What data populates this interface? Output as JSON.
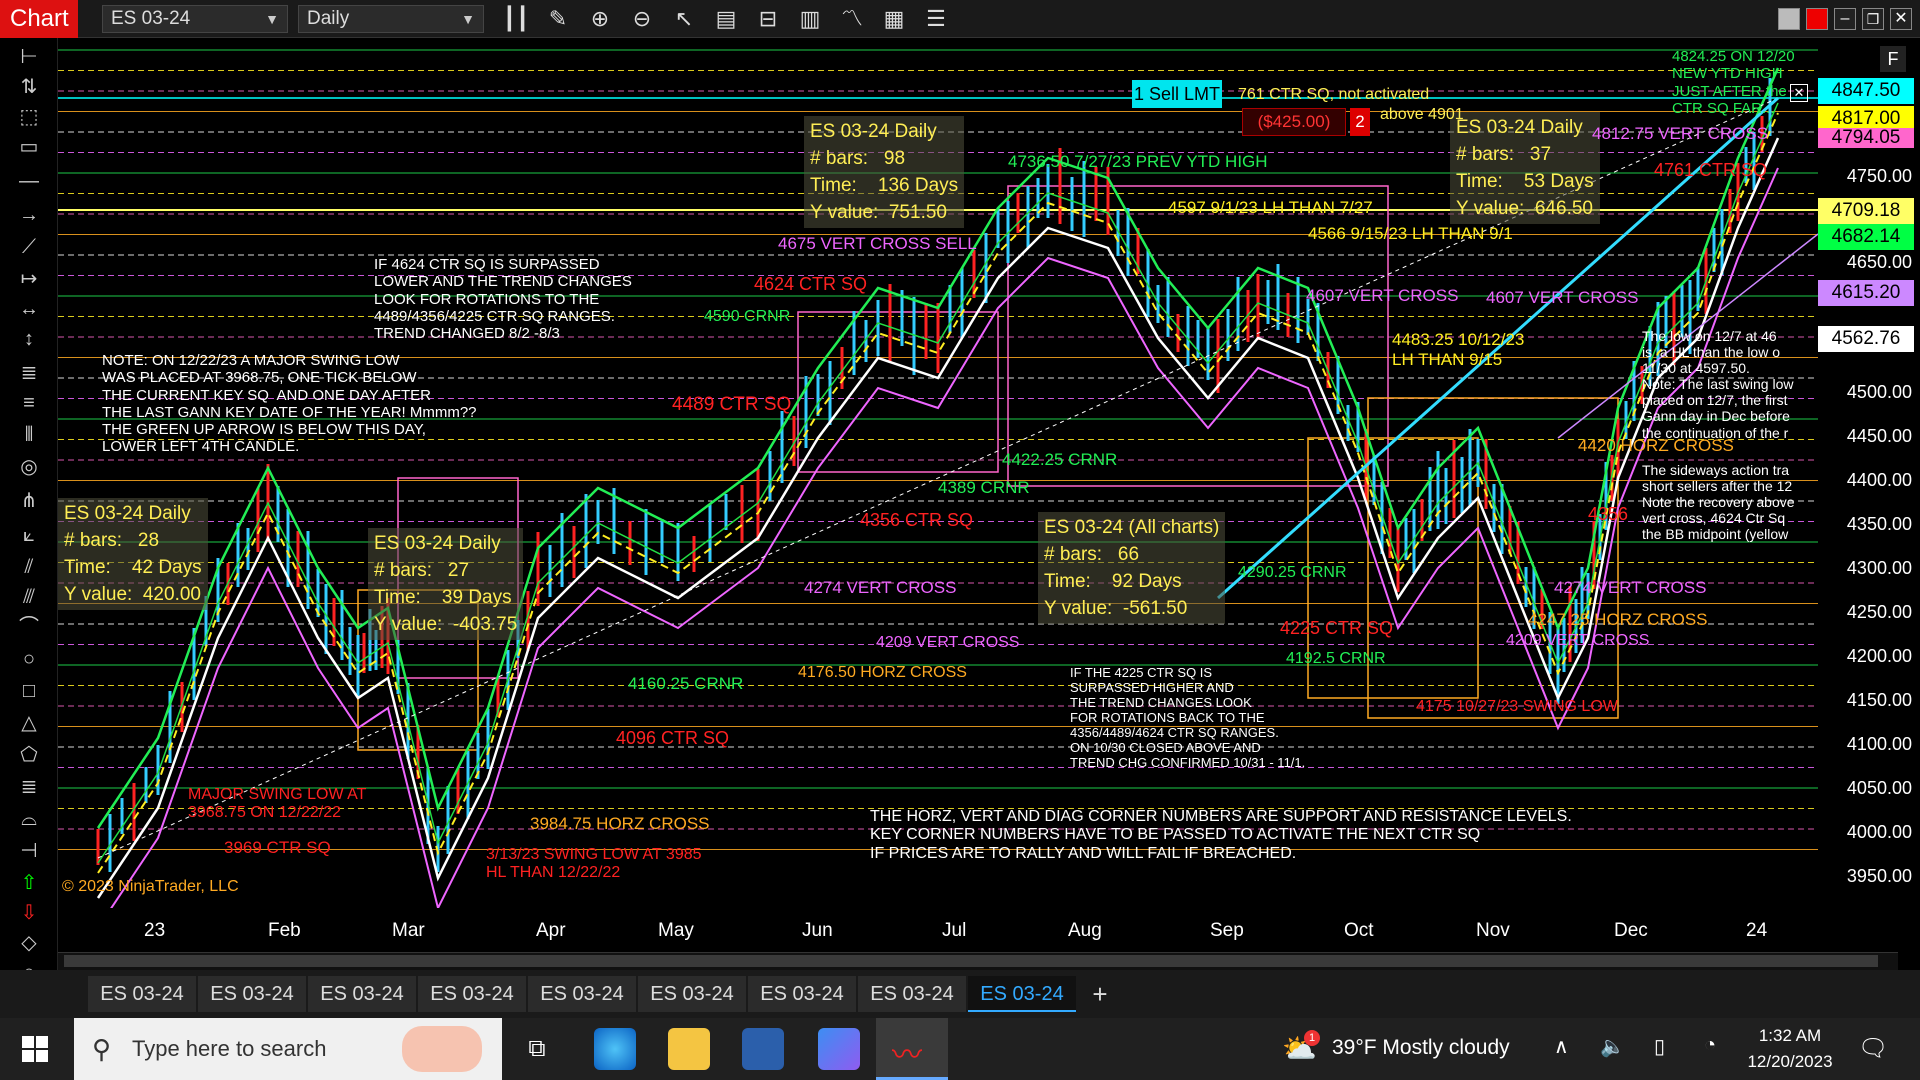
{
  "header": {
    "title": "Chart",
    "instrument": "ES 03-24",
    "interval": "Daily"
  },
  "order": {
    "label": "1 Sell LMT",
    "pnl": "($425.00)",
    "qty": "2"
  },
  "yaxis": {
    "ticks": [
      "4750.00",
      "4650.00",
      "4500.00",
      "4450.00",
      "4400.00",
      "4350.00",
      "4300.00",
      "4250.00",
      "4200.00",
      "4150.00",
      "4100.00",
      "4050.00",
      "4000.00",
      "3950.00"
    ],
    "boxes": [
      {
        "label": "4847.50",
        "color": "#00ffff"
      },
      {
        "label": "4817.00",
        "color": "#ffff00"
      },
      {
        "label": "4794.05",
        "color": "#ff66cc"
      },
      {
        "label": "4709.18",
        "color": "#ffff66"
      },
      {
        "label": "4682.14",
        "color": "#00ff44"
      },
      {
        "label": "4615.20",
        "color": "#cc88ff"
      },
      {
        "label": "4562.76",
        "color": "#ffffff"
      }
    ]
  },
  "xaxis": {
    "ticks": [
      "23",
      "Feb",
      "Mar",
      "Apr",
      "May",
      "Jun",
      "Jul",
      "Aug",
      "Sep",
      "Oct",
      "Nov",
      "Dec",
      "24"
    ]
  },
  "statboxes": [
    {
      "lines": "ES 03-24 Daily\n# bars:   28\nTime:    42 Days\nY value:  420.00"
    },
    {
      "lines": "ES 03-24 Daily\n# bars:   27\nTime:    39 Days\nY value:  -403.75"
    },
    {
      "lines": "ES 03-24 Daily\n# bars:   98\nTime:    136 Days\nY value:  751.50"
    },
    {
      "lines": "ES 03-24 (All charts)\n# bars:   66\nTime:    92 Days\nY value:  -561.50"
    },
    {
      "lines": "ES 03-24 Daily\n# bars:   37\nTime:    53 Days\nY value:  646.50"
    }
  ],
  "annotations": {
    "note_left": "NOTE: ON 12/22/23 A MAJOR SWING LOW\nWAS PLACED AT 3968.75, ONE TICK BELOW\nTHE CURRENT KEY SQ  AND ONE DAY AFTER\nTHE LAST GANN KEY DATE OF THE YEAR! Mmmm??\nTHE GREEN UP ARROW IS BELOW THIS DAY,\nLOWER LEFT 4TH CANDLE.",
    "note_4624": "IF 4624 CTR SQ IS SURPASSED\nLOWER AND THE TREND CHANGES\nLOOK FOR ROTATIONS TO THE\n4489/4356/4225 CTR SQ RANGES.\nTREND CHANGED 8/2 -8/3",
    "note_4225": "IF THE 4225 CTR SQ IS\nSURPASSED HIGHER AND\nTHE TREND CHANGES LOOK\nFOR ROTATIONS BACK TO THE\n4356/4489/4624 CTR SQ RANGES.\nON 10/30 CLOSED ABOVE AND\nTREND CHG CONFIRMED 10/31 - 11/1.",
    "note_bottom": "THE HORZ, VERT AND DIAG CORNER NUMBERS ARE SUPPORT AND RESISTANCE LEVELS.\nKEY CORNER NUMBERS HAVE TO BE PASSED TO ACTIVATE THE NEXT CTR SQ\nIF PRICES ARE TO RALLY AND WILL FAIL IF BREACHED.",
    "note_right": "The low on 12/7 at 46\nis  a HL than the low o\n11/30 at 4597.50.\nNote: The last swing low\nplaced on 12/7, the first \nGann day in Dec before\nthe continuation of the r\n",
    "note_right2": "The sideways action tra\nshort sellers after the 12\nNote the recovery above\nvert cross, 4624 Ctr Sq \nthe BB midpoint (yellow",
    "major_low": "MAJOR SWING LOW AT\n3968.75 ON 12/22/22",
    "ctr3969": "3969 CTR SQ",
    "swing313": "3/13/23 SWING LOW AT 3985\nHL THAN 12/22/22",
    "horz3984": "3984.75 HORZ CROSS",
    "ctr4096": "4096 CTR SQ",
    "crnr4160": "4160.25 CRNR",
    "horz4176": "4176.50 HORZ CROSS",
    "vert4209a": "4209 VERT CROSS",
    "vert4274": "4274 VERT CROSS",
    "ctr4356a": "4356 CTR SQ",
    "crnr4389": "4389 CRNR",
    "crnr4422": "4422.25 CRNR",
    "ctr4489": "4489 CTR SQ",
    "crnr4590": "4590 CRNR",
    "ctr4624": "4624 CTR SQ",
    "vert4675": "4675 VERT CROSS SELL",
    "ytd4736": "4736.50 7/27/23 PREV YTD HIGH",
    "lh4597": "4597 9/1/23 LH THAN 7/27",
    "lh4566": "4566 9/15/23 LH THAN 9/1",
    "vert4607a": "4607 VERT CROSS",
    "vert4607b": "4607 VERT CROSS",
    "lh4483": "4483.25 10/12/23\nLH THAN 9/15",
    "crnr4290": "4290.25 CRNR",
    "ctr4225": "4225 CTR SQ",
    "crnr4192": "4192.5 CRNR",
    "swing4175": "4175 10/27/23 SWING LOW",
    "vert4209b": "4209 VERT CROSS",
    "horz4247": "4247.25 HORZ CROSS",
    "vert4274b": "4274 VERT CROSS",
    "ctr4356b": "4356",
    "horz4420": "4420 HORZ CROSS",
    "ctr4761": "4761 CTR SQ",
    "vert4812": "4812.75 VERT CROSS",
    "ctr4761top": "761 CTR SQ, not activated",
    "above4901": "above 4901",
    "ytd4824": "4824.25 ON 12/20\nNEW YTD HIGH\nJUST AFTER the\nCTR SQ FAR...",
    "copyright": "© 2023 NinjaTrader, LLC"
  },
  "tabs": [
    "ES 03-24",
    "ES 03-24",
    "ES 03-24",
    "ES 03-24",
    "ES 03-24",
    "ES 03-24",
    "ES 03-24",
    "ES 03-24",
    "ES 03-24"
  ],
  "taskbar": {
    "search_placeholder": "Type here to search",
    "weather": "39°F  Mostly cloudy",
    "time": "1:32 AM",
    "date": "12/20/2023",
    "badge": "1"
  }
}
